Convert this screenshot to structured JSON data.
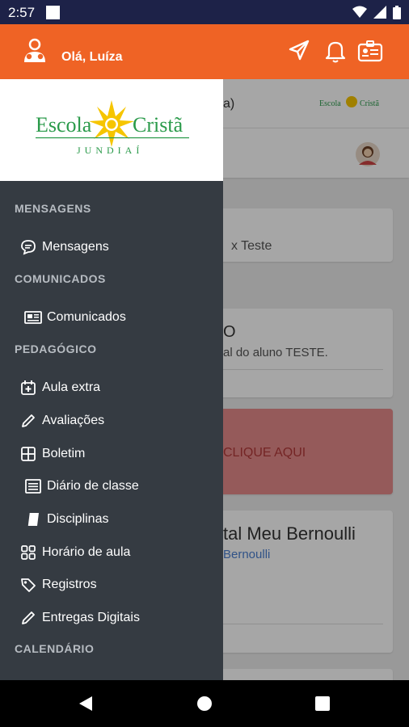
{
  "status_bar": {
    "time": "2:57"
  },
  "app_bar": {
    "greeting": "Olá, Luíza"
  },
  "drawer": {
    "logo": {
      "line1_left": "Escola",
      "line1_right": "Cristã",
      "line2": "JUNDIAÍ"
    },
    "sections": [
      {
        "title": "MENSAGENS",
        "items": [
          {
            "label": "Mensagens",
            "icon": "chat-icon"
          }
        ]
      },
      {
        "title": "COMUNICADOS",
        "items": [
          {
            "label": "Comunicados",
            "icon": "newspaper-icon"
          }
        ]
      },
      {
        "title": "PEDAGÓGICO",
        "items": [
          {
            "label": "Aula extra",
            "icon": "calendar-plus-icon"
          },
          {
            "label": "Avaliações",
            "icon": "pencil-icon"
          },
          {
            "label": "Boletim",
            "icon": "grid-icon"
          },
          {
            "label": "Diário de classe",
            "icon": "list-icon"
          },
          {
            "label": "Disciplinas",
            "icon": "book-icon"
          },
          {
            "label": "Horário de aula",
            "icon": "apps-icon"
          },
          {
            "label": "Registros",
            "icon": "tag-icon"
          },
          {
            "label": "Entregas Digitais",
            "icon": "pencil-icon"
          }
        ]
      },
      {
        "title": "CALENDÁRIO",
        "items": []
      }
    ]
  },
  "background": {
    "header_partial": "a)",
    "card1_partial": "x Teste",
    "card2_title_partial": "O",
    "card2_text_partial": "al do aluno TESTE.",
    "banner_partial": "CLIQUE AQUI",
    "card3_title_partial": "tal Meu Bernoulli",
    "card3_link_partial": "Bernoulli"
  },
  "colors": {
    "app_bar": "#ef6325",
    "drawer": "#353b42",
    "status_bar": "#1d2248",
    "banner": "#e58a8a"
  }
}
